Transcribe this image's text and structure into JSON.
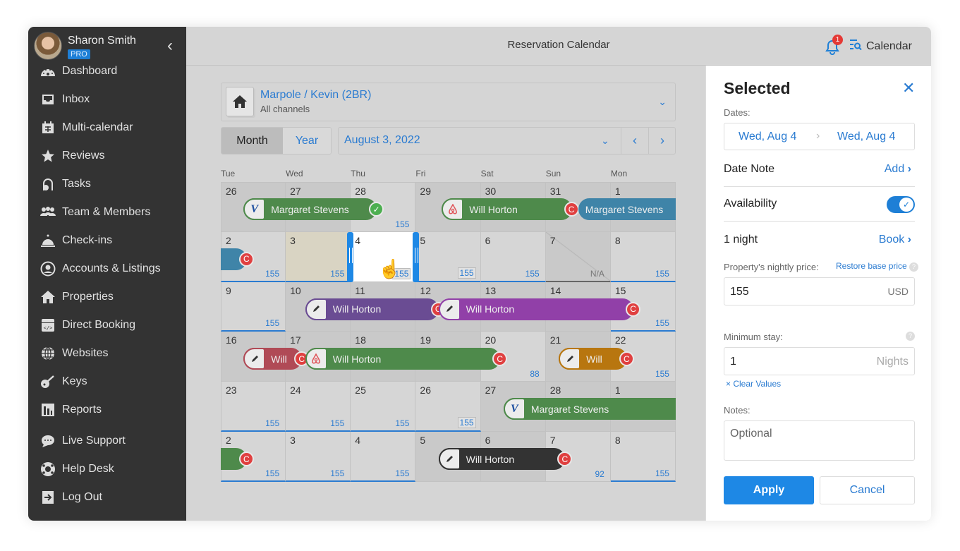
{
  "user": {
    "name": "Sharon Smith",
    "badge": "PRO"
  },
  "sidebar": {
    "collapse_icon": "chevron-left-icon",
    "items": [
      {
        "label": "Dashboard",
        "icon": "dashboard-icon"
      },
      {
        "label": "Inbox",
        "icon": "inbox-icon"
      },
      {
        "label": "Multi-calendar",
        "icon": "calendar-icon"
      },
      {
        "label": "Reviews",
        "icon": "star-icon"
      },
      {
        "label": "Tasks",
        "icon": "vacuum-icon"
      },
      {
        "label": "Team & Members",
        "icon": "users-icon"
      },
      {
        "label": "Check-ins",
        "icon": "bell-concierge-icon"
      },
      {
        "label": "Accounts & Listings",
        "icon": "user-circle-icon"
      },
      {
        "label": "Properties",
        "icon": "home-icon"
      },
      {
        "label": "Direct Booking",
        "icon": "code-window-icon"
      },
      {
        "label": "Websites",
        "icon": "globe-icon"
      },
      {
        "label": "Keys",
        "icon": "key-icon"
      },
      {
        "label": "Reports",
        "icon": "bar-chart-icon"
      },
      {
        "label": "Live Support",
        "icon": "chat-icon"
      },
      {
        "label": "Help Desk",
        "icon": "lifebuoy-icon"
      },
      {
        "label": "Log Out",
        "icon": "logout-icon"
      }
    ]
  },
  "header": {
    "title": "Reservation Calendar",
    "notification_count": "1",
    "calendar_label": "Calendar"
  },
  "property": {
    "name": "Marpole / Kevin (2BR)",
    "channels": "All channels"
  },
  "view": {
    "month": "Month",
    "year": "Year",
    "current_date": "August 3, 2022"
  },
  "weekdays": [
    "Tue",
    "Wed",
    "Thu",
    "Fri",
    "Sat",
    "Sun",
    "Mon"
  ],
  "calendar": {
    "rows": [
      [
        {
          "d": "26",
          "p": "",
          "t": "dark"
        },
        {
          "d": "27",
          "p": "",
          "t": "dark"
        },
        {
          "d": "28",
          "p": "155",
          "t": "light"
        },
        {
          "d": "29",
          "p": "",
          "t": "dark"
        },
        {
          "d": "30",
          "p": "",
          "t": "dark"
        },
        {
          "d": "31",
          "p": "",
          "t": "dark"
        },
        {
          "d": "1",
          "p": "",
          "t": "dark"
        }
      ],
      [
        {
          "d": "2",
          "p": "155",
          "t": "light",
          "u": "b"
        },
        {
          "d": "3",
          "p": "155",
          "t": "beige",
          "u": "b"
        },
        {
          "d": "4",
          "p": "155",
          "t": "sel",
          "box": true
        },
        {
          "d": "5",
          "p": "155",
          "t": "light",
          "u": "b",
          "box": true
        },
        {
          "d": "6",
          "p": "155",
          "t": "light",
          "u": "b"
        },
        {
          "d": "7",
          "p": "N/A",
          "t": "diag",
          "u": "g"
        },
        {
          "d": "8",
          "p": "155",
          "t": "light",
          "u": "b"
        }
      ],
      [
        {
          "d": "9",
          "p": "155",
          "t": "light",
          "u": "b"
        },
        {
          "d": "10",
          "p": "",
          "t": "dark"
        },
        {
          "d": "11",
          "p": "",
          "t": "dark"
        },
        {
          "d": "12",
          "p": "",
          "t": "dark"
        },
        {
          "d": "13",
          "p": "",
          "t": "dark"
        },
        {
          "d": "14",
          "p": "",
          "t": "dark"
        },
        {
          "d": "15",
          "p": "155",
          "t": "light",
          "u": "b"
        }
      ],
      [
        {
          "d": "16",
          "p": "",
          "t": "dark"
        },
        {
          "d": "17",
          "p": "",
          "t": "dark"
        },
        {
          "d": "18",
          "p": "",
          "t": "dark"
        },
        {
          "d": "19",
          "p": "",
          "t": "dark"
        },
        {
          "d": "20",
          "p": "88",
          "t": "light"
        },
        {
          "d": "21",
          "p": "",
          "t": "dark"
        },
        {
          "d": "22",
          "p": "155",
          "t": "light"
        }
      ],
      [
        {
          "d": "23",
          "p": "155",
          "t": "light",
          "u": "b"
        },
        {
          "d": "24",
          "p": "155",
          "t": "light",
          "u": "b"
        },
        {
          "d": "25",
          "p": "155",
          "t": "light",
          "u": "b"
        },
        {
          "d": "26",
          "p": "155",
          "t": "light",
          "u": "b",
          "box": true
        },
        {
          "d": "27",
          "p": "",
          "t": "dark"
        },
        {
          "d": "28",
          "p": "",
          "t": "dark"
        },
        {
          "d": "1",
          "p": "",
          "t": "dark"
        }
      ],
      [
        {
          "d": "2",
          "p": "155",
          "t": "light",
          "u": "b"
        },
        {
          "d": "3",
          "p": "155",
          "t": "light",
          "u": "b"
        },
        {
          "d": "4",
          "p": "155",
          "t": "light",
          "u": "b"
        },
        {
          "d": "5",
          "p": "",
          "t": "dark"
        },
        {
          "d": "6",
          "p": "",
          "t": "dark"
        },
        {
          "d": "7",
          "p": "92",
          "t": "light"
        },
        {
          "d": "8",
          "p": "155",
          "t": "light",
          "u": "b"
        }
      ]
    ],
    "reservations": [
      {
        "guest": "Margaret Stevens",
        "row": 0,
        "start": 0.35,
        "end": 2.4,
        "color": "#4e8a4b",
        "channel": "vrbo",
        "status": "confirmed"
      },
      {
        "guest": "Will Horton",
        "row": 0,
        "start": 3.4,
        "end": 5.4,
        "color": "#4e8a4b",
        "channel": "airbnb",
        "status": "cancelled"
      },
      {
        "guest": "Margaret Stevens",
        "row": 0,
        "start": 5.5,
        "end": 7.2,
        "color": "#3f84a8",
        "channel": "none",
        "status": ""
      },
      {
        "guest": "",
        "row": 1,
        "start": -0.3,
        "end": 0.4,
        "color": "#3f84a8",
        "channel": "none",
        "status": "cancelled"
      },
      {
        "guest": "Will Horton",
        "row": 2,
        "start": 1.3,
        "end": 3.35,
        "color": "#6a4c93",
        "channel": "direct",
        "status": "cancelled"
      },
      {
        "guest": "Will Horton",
        "row": 2,
        "start": 3.35,
        "end": 6.35,
        "color": "#9140a8",
        "channel": "direct",
        "status": "cancelled"
      },
      {
        "guest": "Will",
        "row": 3,
        "start": 0.35,
        "end": 1.25,
        "color": "#b04a56",
        "channel": "direct",
        "status": "cancelled"
      },
      {
        "guest": "Will Horton",
        "row": 3,
        "start": 1.3,
        "end": 4.3,
        "color": "#4e8a4b",
        "channel": "airbnb",
        "status": "cancelled"
      },
      {
        "guest": "Will",
        "row": 3,
        "start": 5.2,
        "end": 6.25,
        "color": "#b8760f",
        "channel": "direct",
        "status": "cancelled"
      },
      {
        "guest": "Margaret Stevens",
        "row": 4,
        "start": 4.35,
        "end": 7.2,
        "color": "#4e8a4b",
        "channel": "vrbo",
        "status": ""
      },
      {
        "guest": "",
        "row": 5,
        "start": -0.3,
        "end": 0.4,
        "color": "#4e8a4b",
        "channel": "none",
        "status": "cancelled"
      },
      {
        "guest": "Will Horton",
        "row": 5,
        "start": 3.35,
        "end": 5.3,
        "color": "#333333",
        "channel": "direct",
        "status": "cancelled"
      }
    ],
    "status_letter_cancelled": "C",
    "selected_day": "4"
  },
  "panel": {
    "title": "Selected",
    "dates_label": "Dates:",
    "date_from": "Wed, Aug 4",
    "date_to": "Wed, Aug 4",
    "date_note_label": "Date Note",
    "date_note_action": "Add",
    "availability_label": "Availability",
    "availability_on": true,
    "nights_label": "1 night",
    "book_action": "Book",
    "price_label": "Property's nightly price:",
    "restore_label": "Restore base price",
    "price_value": "155",
    "currency": "USD",
    "min_stay_label": "Minimum stay:",
    "min_stay_value": "1",
    "min_stay_unit": "Nights",
    "clear_values": "× Clear Values",
    "notes_label": "Notes:",
    "notes_placeholder": "Optional",
    "apply": "Apply",
    "cancel": "Cancel"
  },
  "colors": {
    "accent": "#1e7fd6",
    "sidebar": "#333333",
    "cancelled": "#e04040",
    "confirmed": "#4caf50"
  }
}
